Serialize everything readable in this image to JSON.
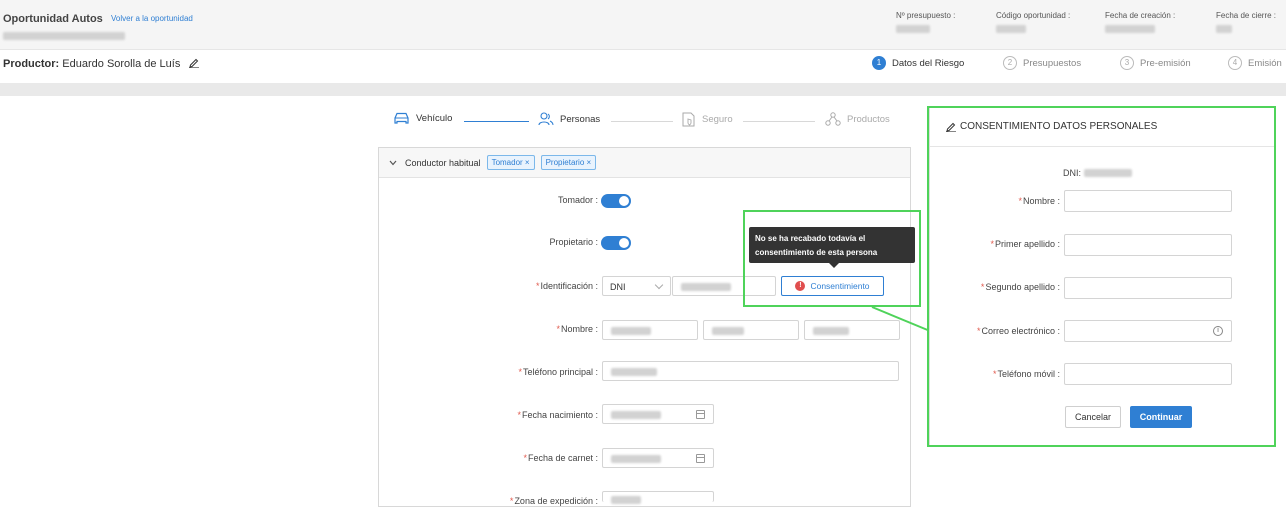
{
  "header": {
    "title": "Oportunidad Autos",
    "back_link": "Volver a la oportunidad",
    "meta": [
      {
        "label": "Nº presupuesto :"
      },
      {
        "label": "Código oportunidad :"
      },
      {
        "label": "Fecha de creación :"
      },
      {
        "label": "Fecha de cierre :"
      }
    ]
  },
  "producer": {
    "label": "Productor:",
    "name": "Eduardo Sorolla de Luís"
  },
  "steps": [
    {
      "num": "1",
      "label": "Datos del Riesgo",
      "active": true
    },
    {
      "num": "2",
      "label": "Presupuestos",
      "active": false
    },
    {
      "num": "3",
      "label": "Pre-emisión",
      "active": false
    },
    {
      "num": "4",
      "label": "Emisión",
      "active": false
    }
  ],
  "tabs": {
    "vehicle": "Vehículo",
    "persons": "Personas",
    "insurance": "Seguro",
    "products": "Productos"
  },
  "panel": {
    "title": "Conductor habitual",
    "tags": [
      "Tomador",
      "Propietario"
    ],
    "tag_close": "×"
  },
  "form": {
    "tomador_label": "Tomador :",
    "propietario_label": "Propietario :",
    "id_label": "Identificación :",
    "id_type": "DNI",
    "consent_button": "Consentimiento",
    "nombre_label": "Nombre :",
    "telefono_label": "Teléfono principal :",
    "fecha_nac_label": "Fecha nacimiento :",
    "fecha_carnet_label": "Fecha de carnet :",
    "zona_label": "Zona de expedición :"
  },
  "tooltip": {
    "line1": "No se ha recabado todavía el",
    "line2": "consentimiento de esta persona"
  },
  "modal": {
    "title": "CONSENTIMIENTO DATOS PERSONALES",
    "dni_label": "DNI:",
    "fields": {
      "nombre": "Nombre :",
      "primer_apellido": "Primer apellido :",
      "segundo_apellido": "Segundo apellido :",
      "correo": "Correo electrónico :",
      "movil": "Teléfono móvil :"
    },
    "cancel": "Cancelar",
    "continue": "Continuar"
  },
  "colors": {
    "accent": "#2f7fd3",
    "highlight": "#4fd35a",
    "required": "#e15b4f",
    "alert": "#e04e4e"
  }
}
